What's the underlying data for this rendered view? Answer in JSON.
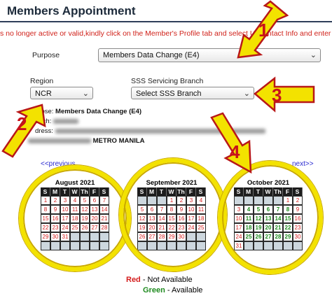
{
  "header": {
    "title": "Members Appointment"
  },
  "notice": "s no longer active or valid,kindly click on the Member's Profile tab and select U... ontact Info and enter",
  "form": {
    "purpose_label": "Purpose",
    "purpose_value": "Members Data Change (E4)",
    "region_label": "Region",
    "region_value": "NCR",
    "branch_label": "SSS Servicing Branch",
    "branch_value": "Select SSS Branch"
  },
  "info": {
    "purpose_prefix": "rpose:",
    "purpose_value": "Members Data Change (E4)",
    "branch_prefix": "anch:",
    "address_prefix": "dress:",
    "address_suffix": "METRO MANILA"
  },
  "nav": {
    "previous": "<<previous",
    "next": "next>>"
  },
  "calendars": [
    {
      "month": "August 2021"
    },
    {
      "month": "September 2021"
    },
    {
      "month": "October 2021"
    }
  ],
  "weekdays": [
    "S",
    "M",
    "T",
    "W",
    "Th",
    "F",
    "S"
  ],
  "legend": {
    "red_word": "Red",
    "red_text": " - Not Available",
    "green_word": "Green",
    "green_text": " - Available"
  },
  "markers": [
    "1",
    "2",
    "3",
    "4"
  ],
  "colors": {
    "red": "#d41c1c",
    "green": "#1e8a1e",
    "ring": "#f3e200",
    "marker": "#f3e200"
  }
}
